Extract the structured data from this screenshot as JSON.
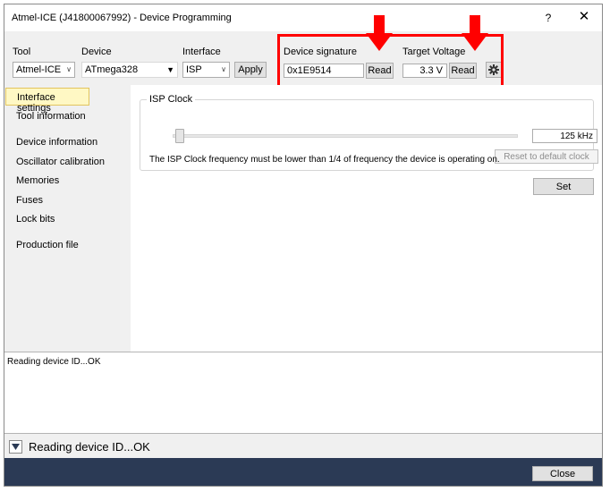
{
  "window": {
    "title": "Atmel-ICE (J41800067992) - Device Programming",
    "help_glyph": "?",
    "close_glyph": "✕"
  },
  "toolbar": {
    "tool_label": "Tool",
    "tool_value": "Atmel-ICE",
    "device_label": "Device",
    "device_value": "ATmega328",
    "interface_label": "Interface",
    "interface_value": "ISP",
    "apply_label": "Apply",
    "signature_label": "Device signature",
    "signature_value": "0x1E9514",
    "signature_read_label": "Read",
    "voltage_label": "Target Voltage",
    "voltage_value": "3.3 V",
    "voltage_read_label": "Read",
    "settings_icon": "gear-icon"
  },
  "sidebar": {
    "items": [
      {
        "label": "Interface settings",
        "active": true
      },
      {
        "label": "Tool information",
        "active": false
      },
      {
        "label": "Device information",
        "active": false
      },
      {
        "label": "Oscillator calibration",
        "active": false
      },
      {
        "label": "Memories",
        "active": false
      },
      {
        "label": "Fuses",
        "active": false
      },
      {
        "label": "Lock bits",
        "active": false
      },
      {
        "label": "Production file",
        "active": false
      }
    ]
  },
  "isp": {
    "group_title": "ISP Clock",
    "clock_value": "125 kHz",
    "slider_level": 0.02,
    "reset_label": "Reset to default clock",
    "info_text": "The ISP Clock frequency must be lower than 1/4 of frequency the device is operating on.",
    "set_label": "Set"
  },
  "log": {
    "text": "Reading device ID...OK"
  },
  "status": {
    "text": "Reading device ID...OK",
    "toggle_icon": "chevron-down-icon"
  },
  "footer": {
    "close_label": "Close"
  },
  "colors": {
    "annotation": "#ff0000",
    "footer_bg": "#2b3a55",
    "active_nav_bg": "#fff8c4"
  }
}
